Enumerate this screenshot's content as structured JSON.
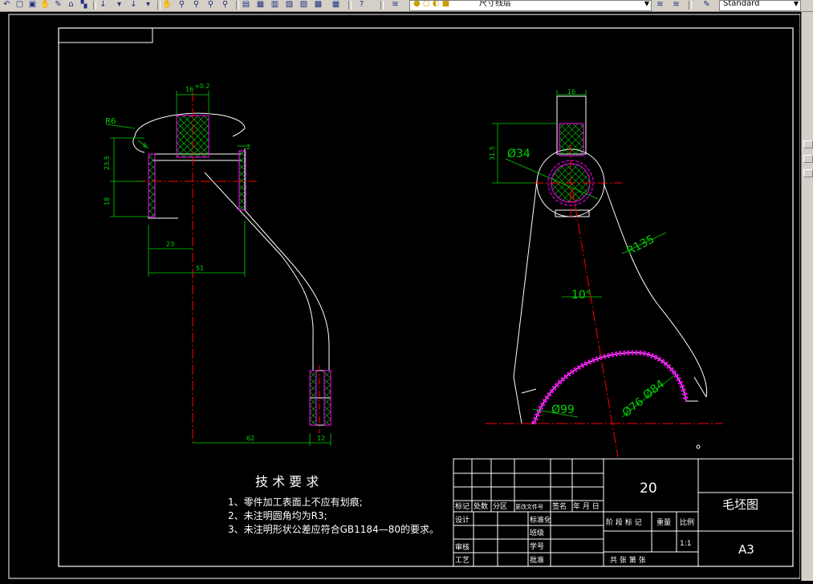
{
  "toolbar": {
    "layer_name": "尺寸线层",
    "style_name": "Standard",
    "icons": [
      "undo-icon",
      "new-icon",
      "open-icon",
      "pan-icon",
      "zoom-realtime-icon",
      "zoom-window-icon",
      "zoom-prev-icon",
      "properties-icon",
      "design-center-icon",
      "tool-palette-icon",
      "markup-icon",
      "calculator-icon",
      "help-icon",
      "layer-manager-icon",
      "layer-state-icon",
      "text-style-icon"
    ]
  },
  "drawing": {
    "left_view": {
      "r6": "R6",
      "d16": "16",
      "d16_tol": "+0.2",
      "d6": "6",
      "d2": "2",
      "d23_5": "23.5",
      "d18": "18",
      "d23": "23",
      "d51": "51",
      "d62": "62",
      "d12": "12"
    },
    "right_view": {
      "d16": "16",
      "d31_5": "31.5",
      "phi34": "Ø34",
      "r135": "R135",
      "angle10": "10°",
      "phi99": "Ø99",
      "phi76": "Ø76",
      "phi84": "Ø84"
    }
  },
  "tech_req": {
    "title": "技 术 要 求",
    "items": [
      "1、零件加工表面上不应有划痕;",
      "2、未注明圆角均为R3;",
      "3、未注明形状公差应符合GB1184—80的要求。"
    ]
  },
  "title_block": {
    "rev_headers": [
      "标记",
      "处数",
      "分区",
      "更改文件号",
      "签名",
      "年 月 日"
    ],
    "role_labels": [
      "设计",
      "标准化",
      "审核",
      "工艺",
      "批准"
    ],
    "right_labels": [
      "标准化",
      "班级",
      "学号",
      "批准"
    ],
    "part_number": "20",
    "drawing_name": "毛坯图",
    "stage_labels": [
      "阶 段 标 记",
      "重量",
      "比例"
    ],
    "scale": "1:1",
    "sheets": "共    张  第    张",
    "paper_size": "A3"
  },
  "colors": {
    "outline": "#ffffff",
    "dimension": "#00d400",
    "centerline": "#ff0000",
    "hatch": "#00ff00",
    "hidden": "#ff00ff"
  }
}
